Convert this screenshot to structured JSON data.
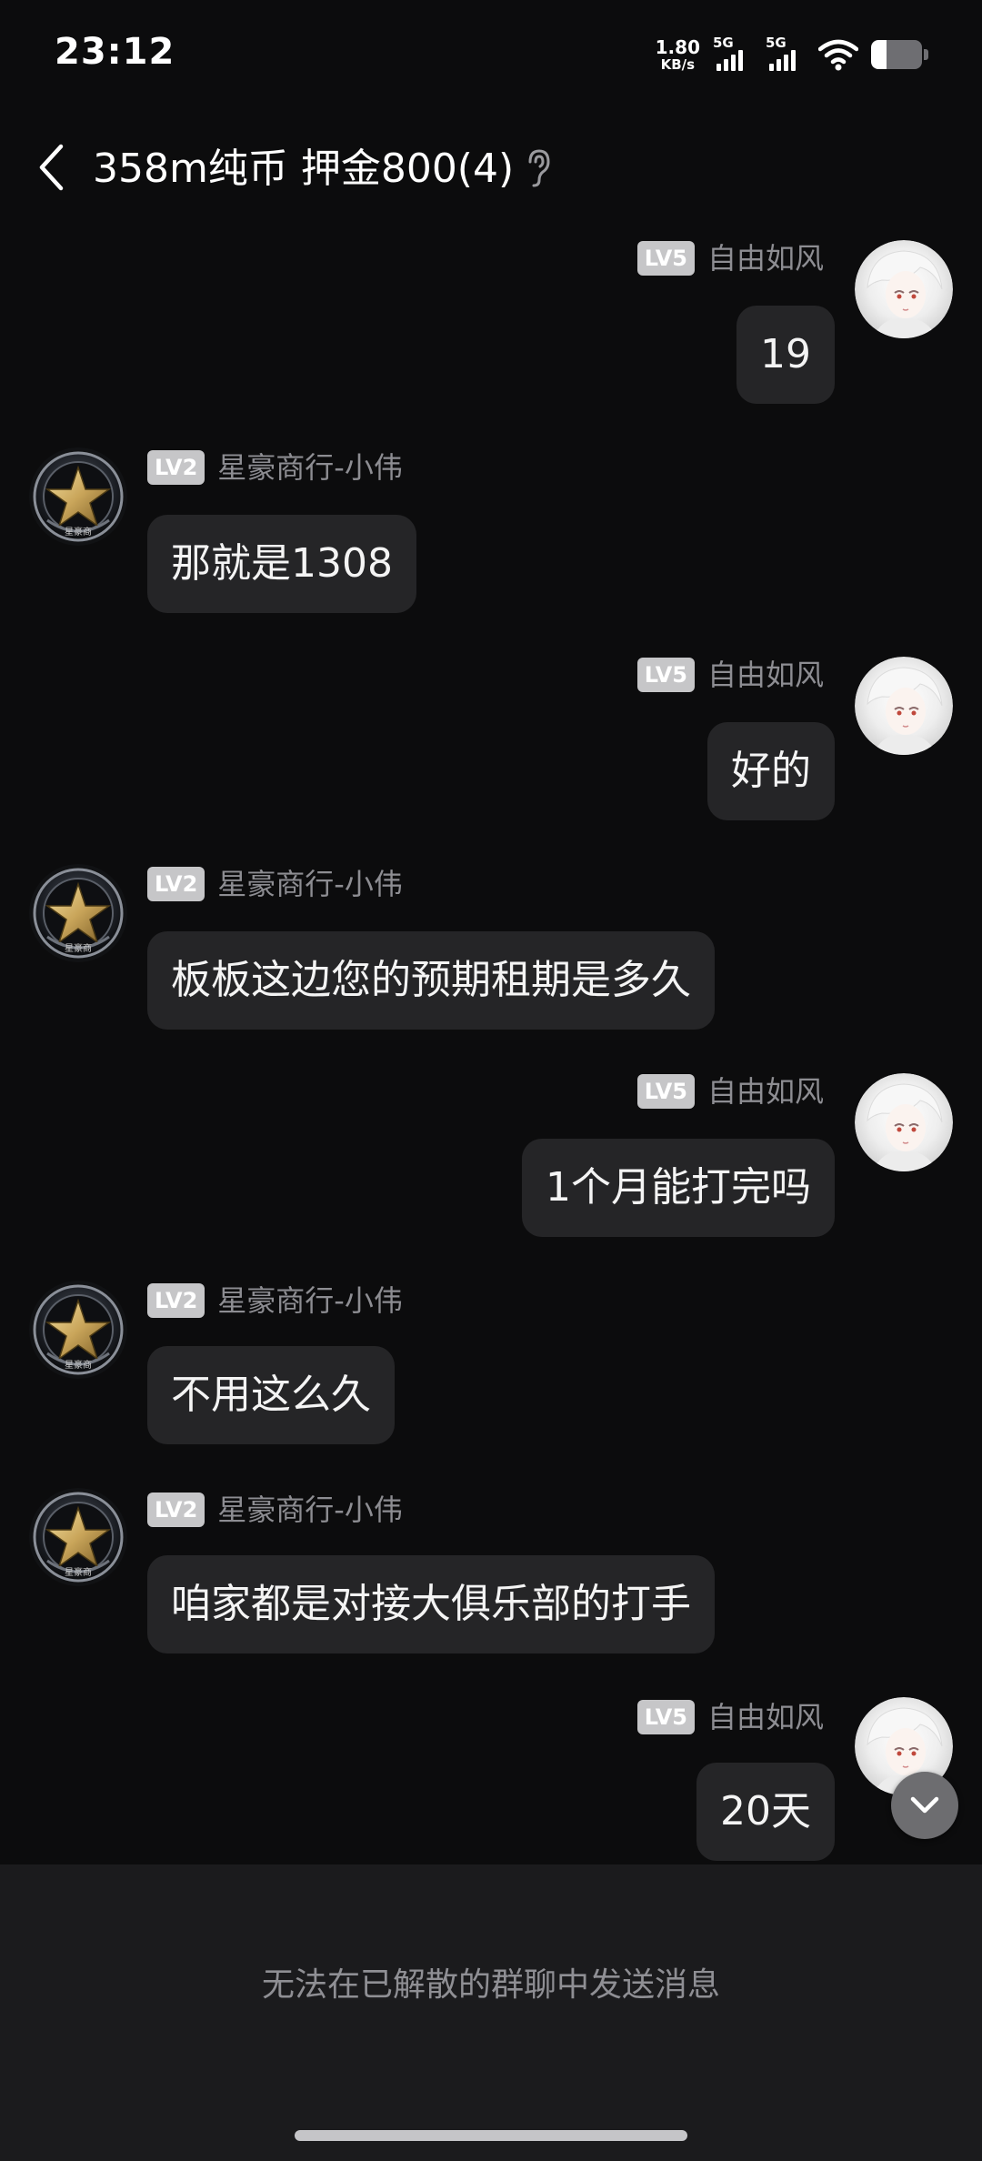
{
  "status_bar": {
    "time": "23:12",
    "net_speed_value": "1.80",
    "net_speed_unit": "KB/s",
    "signal1_label": "5G",
    "signal2_label": "5G",
    "battery_level": 0.3
  },
  "header": {
    "title": "358m纯币 押金800(4)",
    "back_icon": "chevron-left-icon",
    "ear_icon": "ear-icon"
  },
  "messages": [
    {
      "side": "right",
      "level": "LV5",
      "sender": "自由如风",
      "text": "19"
    },
    {
      "side": "left",
      "level": "LV2",
      "sender": "星豪商行-小伟",
      "text": "那就是1308"
    },
    {
      "side": "right",
      "level": "LV5",
      "sender": "自由如风",
      "text": "好的"
    },
    {
      "side": "left",
      "level": "LV2",
      "sender": "星豪商行-小伟",
      "text": "板板这边您的预期租期是多久"
    },
    {
      "side": "right",
      "level": "LV5",
      "sender": "自由如风",
      "text": "1个月能打完吗"
    },
    {
      "side": "left",
      "level": "LV2",
      "sender": "星豪商行-小伟",
      "text": "不用这么久"
    },
    {
      "side": "left",
      "level": "LV2",
      "sender": "星豪商行-小伟",
      "text": "咱家都是对接大俱乐部的打手"
    },
    {
      "side": "right",
      "level": "LV5",
      "sender": "自由如风",
      "text": "20天"
    }
  ],
  "avatar_text": "星豪商",
  "footer": {
    "disabled_notice": "无法在已解散的群聊中发送消息"
  }
}
